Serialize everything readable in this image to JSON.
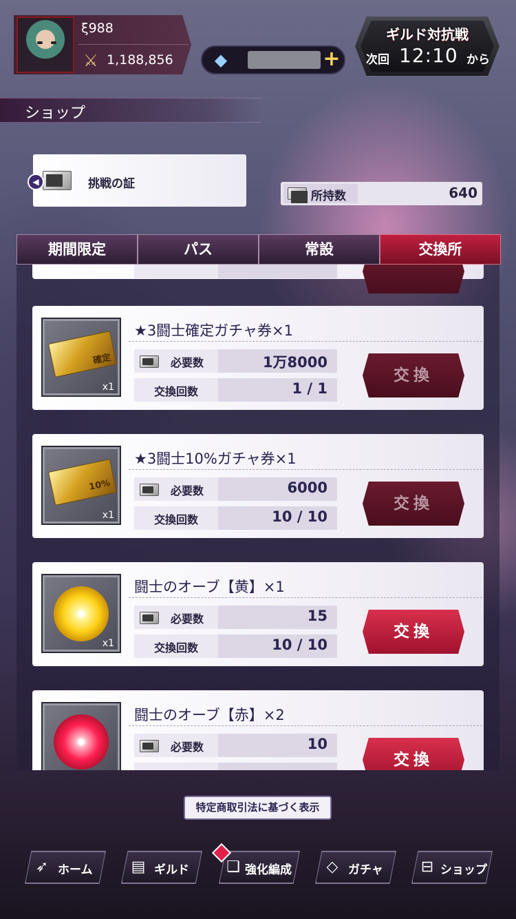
{
  "player": {
    "name": "ξ988",
    "power": "1,188,856"
  },
  "gems": {
    "plus_label": "+"
  },
  "guild_battle": {
    "title": "ギルド対抗戦",
    "next_label": "次回",
    "time": "12:10",
    "from_label": "から"
  },
  "shop": {
    "title": "ショップ"
  },
  "currency": {
    "name": "挑戦の証",
    "owned_label": "所持数",
    "owned_value": "640"
  },
  "tabs": [
    {
      "label": "期間限定",
      "active": false
    },
    {
      "label": "パス",
      "active": false
    },
    {
      "label": "常設",
      "active": false
    },
    {
      "label": "交換所",
      "active": true
    }
  ],
  "items": [
    {
      "title": "★3闘士確定ガチャ券×1",
      "thumb_qty": "x1",
      "thumb_text": "確定",
      "cost_label": "必要数",
      "cost_value": "1万8000",
      "count_label": "交換回数",
      "count_value": "1 / 1",
      "button_label": "交換",
      "enabled": false
    },
    {
      "title": "★3闘士10%ガチャ券×1",
      "thumb_qty": "x1",
      "thumb_text": "10%",
      "cost_label": "必要数",
      "cost_value": "6000",
      "count_label": "交換回数",
      "count_value": "10 / 10",
      "button_label": "交換",
      "enabled": false
    },
    {
      "title": "闘士のオーブ【黄】×1",
      "thumb_qty": "x1",
      "cost_label": "必要数",
      "cost_value": "15",
      "count_label": "交換回数",
      "count_value": "10 / 10",
      "button_label": "交換",
      "enabled": true
    },
    {
      "title": "闘士のオーブ【赤】×2",
      "cost_label": "必要数",
      "cost_value": "10",
      "button_label": "交換",
      "enabled": true
    }
  ],
  "footer": {
    "legal_label": "特定商取引法に基づく表示"
  },
  "nav": [
    {
      "label": "ホーム",
      "icon": "wing-icon"
    },
    {
      "label": "ギルド",
      "icon": "guild-card-icon"
    },
    {
      "label": "強化編成",
      "icon": "enhance-icon"
    },
    {
      "label": "ガチャ",
      "icon": "diamond-icon"
    },
    {
      "label": "ショップ",
      "icon": "shop-icon"
    }
  ],
  "colors": {
    "accent_red": "#c02040",
    "card_text": "#2a2450"
  }
}
